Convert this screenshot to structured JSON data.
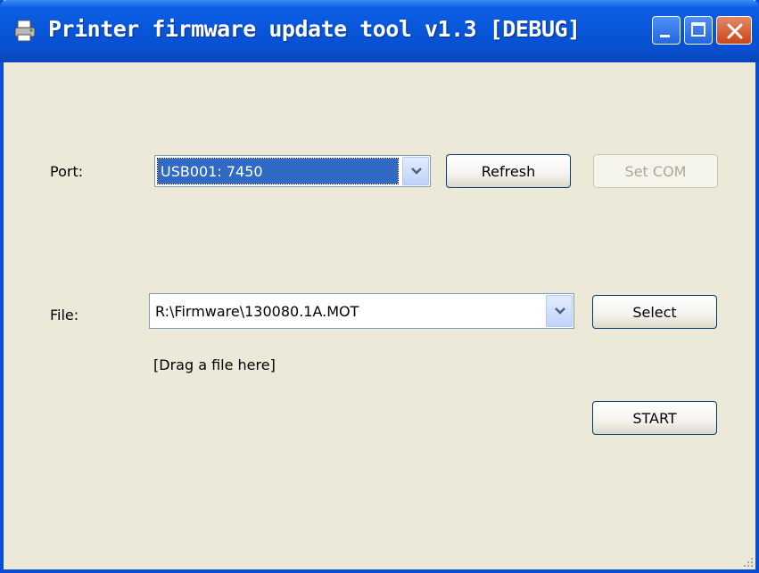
{
  "window": {
    "title": "Printer firmware update tool v1.3 [DEBUG]",
    "icon": "printer-icon",
    "controls": [
      "minimize-icon",
      "maximize-icon",
      "close-icon"
    ]
  },
  "port": {
    "label": "Port:",
    "selected": "USB001: 7450",
    "refresh_label": "Refresh",
    "set_com_label": "Set COM"
  },
  "file": {
    "label": "File:",
    "value": "R:\\Firmware\\130080.1A.MOT",
    "select_label": "Select",
    "drop_hint": "[Drag a file here]"
  },
  "actions": {
    "start_label": "START"
  },
  "colors": {
    "titlebar": "#0754d6",
    "window_bg": "#ece9d8",
    "selection": "#316ac5",
    "close_button": "#c94617"
  }
}
